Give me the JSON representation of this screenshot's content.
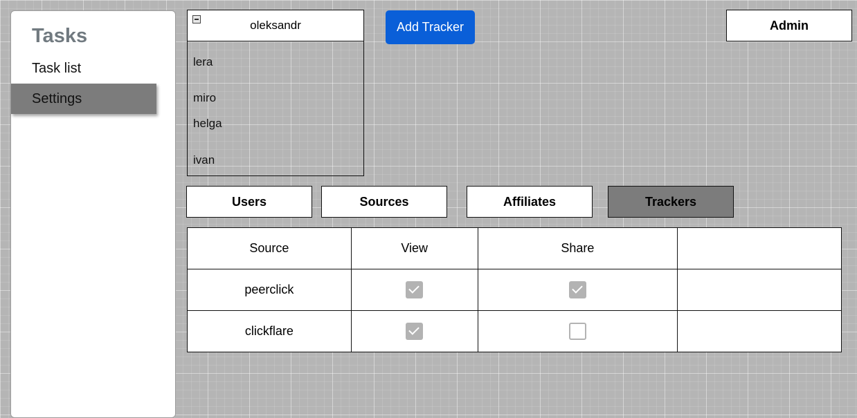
{
  "sidebar": {
    "title": "Tasks",
    "items": [
      {
        "label": "Task list"
      },
      {
        "label": "Settings"
      }
    ]
  },
  "user_dropdown": {
    "selected": "oleksandr",
    "options": [
      "lera",
      "miro",
      "helga",
      "ivan"
    ]
  },
  "toolbar": {
    "add_tracker_label": "Add Tracker",
    "admin_label": "Admin"
  },
  "tabs": [
    {
      "label": "Users",
      "active": false
    },
    {
      "label": "Sources",
      "active": false
    },
    {
      "label": "Affiliates",
      "active": false
    },
    {
      "label": "Trackers",
      "active": true
    }
  ],
  "table": {
    "columns": [
      "Source",
      "View",
      "Share",
      ""
    ],
    "rows": [
      {
        "source": "peerclick",
        "view": true,
        "share": true
      },
      {
        "source": "clickflare",
        "view": true,
        "share": false
      }
    ]
  },
  "colors": {
    "accent": "#0a5fd8",
    "active_tab": "#7c7c7c",
    "checkbox": "#b3b3b3"
  }
}
